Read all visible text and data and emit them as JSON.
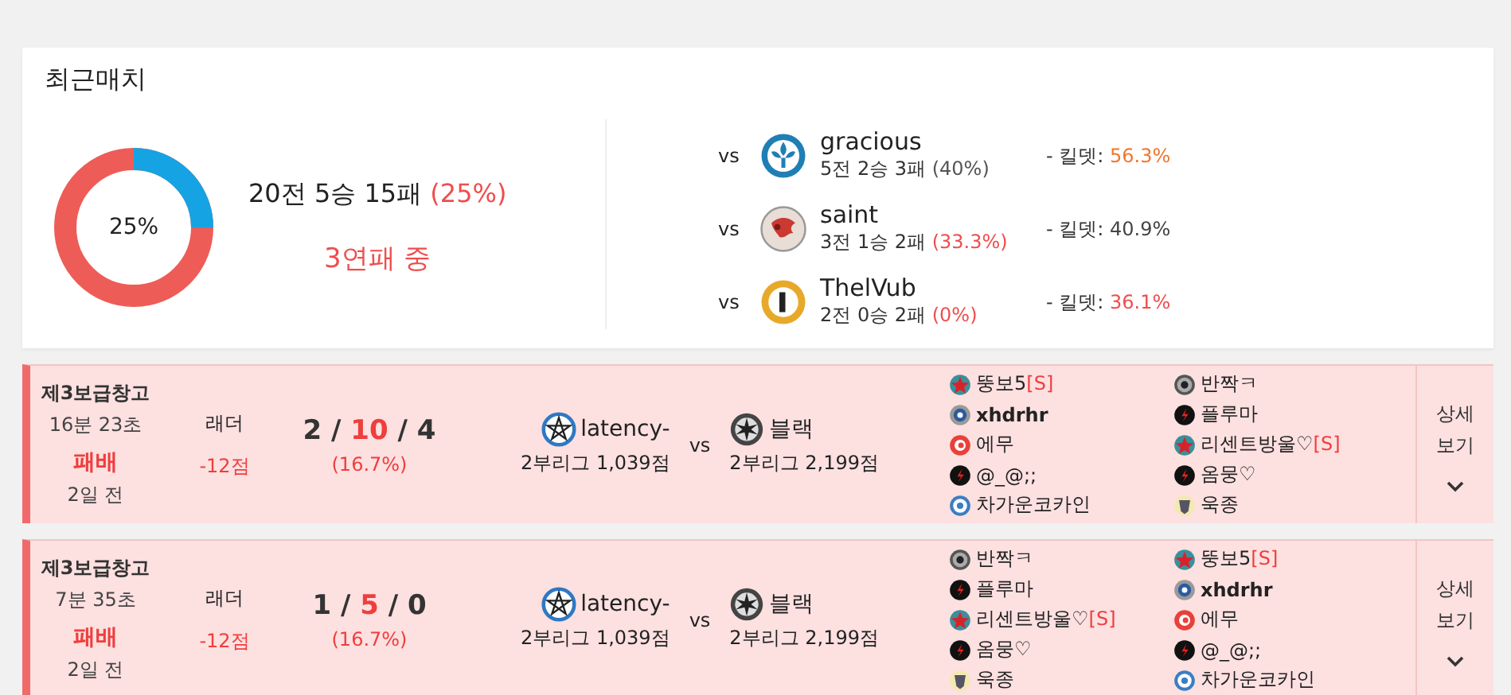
{
  "title": "최근매치",
  "summary": {
    "level": 0.25,
    "center_label": "25%",
    "record": "20전 5승 15패",
    "record_rate": "(25%)",
    "streak": "3연패 중"
  },
  "opponents": [
    {
      "vs": "vs",
      "kind": "fleur",
      "name": "gracious",
      "record": "5전 2승 3패",
      "rate": {
        "text": "(40%)",
        "color": "#555555"
      },
      "kd_label": "- 킬뎃:",
      "kd": {
        "text": "56.3%",
        "color": "#f0762f"
      }
    },
    {
      "vs": "vs",
      "kind": "dragon",
      "name": "saint",
      "record": "3전 1승 2패",
      "rate": {
        "text": "(33.3%)",
        "color": "#ef4e4e"
      },
      "kd_label": "- 킬뎃:",
      "kd": {
        "text": "40.9%",
        "color": "#444444"
      }
    },
    {
      "vs": "vs",
      "kind": "number",
      "name": "ThelVub",
      "record": "2전 0승 2패",
      "rate": {
        "text": "(0%)",
        "color": "#ef4e4e"
      },
      "kd_label": "- 킬뎃:",
      "kd": {
        "text": "36.1%",
        "color": "#ef4e4e"
      }
    }
  ],
  "matches": [
    {
      "kind": "loss",
      "map": "제3보급창고",
      "duration": "16분 23초",
      "result": "패배",
      "ago": "2일 전",
      "mode": "래더",
      "points": "-12점",
      "kills": "2",
      "deaths": "10",
      "assists": "4",
      "separator": "/",
      "ratio": "(16.7%)",
      "team": {
        "kind": "pentagram",
        "name": "latency-",
        "league": "2부리그 1,039점"
      },
      "vs": "vs",
      "opponent": {
        "kind": "sunburst",
        "name": "블랙",
        "league": "2부리그 2,199점"
      },
      "players": [
        [
          {
            "kind": "star",
            "name": "뚱보5",
            "tag": "[S]",
            "me": false
          },
          {
            "kind": "wheel",
            "name": "xhdrhr",
            "me": true
          },
          {
            "kind": "swirl",
            "name": "에무",
            "me": false
          },
          {
            "kind": "bolt",
            "name": "@_@;;",
            "me": false
          },
          {
            "kind": "gear",
            "name": "차가운코카인",
            "me": false
          }
        ],
        [
          {
            "kind": "radial",
            "name": "반짝ㅋ",
            "me": false
          },
          {
            "kind": "bolt",
            "name": "플루마",
            "me": false
          },
          {
            "kind": "star",
            "name": "리센트방울♡",
            "tag": "[S]",
            "me": false
          },
          {
            "kind": "bolt",
            "name": "옴뭉♡",
            "me": false
          },
          {
            "kind": "shield",
            "name": "욱종",
            "me": false
          }
        ]
      ],
      "detail": "상세 보기"
    },
    {
      "kind": "loss",
      "map": "제3보급창고",
      "duration": "7분 35초",
      "result": "패배",
      "ago": "2일 전",
      "mode": "래더",
      "points": "-12점",
      "kills": "1",
      "deaths": "5",
      "assists": "0",
      "separator": "/",
      "ratio": "(16.7%)",
      "team": {
        "kind": "pentagram",
        "name": "latency-",
        "league": "2부리그 1,039점"
      },
      "vs": "vs",
      "opponent": {
        "kind": "sunburst",
        "name": "블랙",
        "league": "2부리그 2,199점"
      },
      "players": [
        [
          {
            "kind": "radial",
            "name": "반짝ㅋ",
            "me": false
          },
          {
            "kind": "bolt",
            "name": "플루마",
            "me": false
          },
          {
            "kind": "star",
            "name": "리센트방울♡",
            "tag": "[S]",
            "me": false
          },
          {
            "kind": "bolt",
            "name": "옴뭉♡",
            "me": false
          },
          {
            "kind": "shield",
            "name": "욱종",
            "me": false
          }
        ],
        [
          {
            "kind": "star",
            "name": "뚱보5",
            "tag": "[S]",
            "me": false
          },
          {
            "kind": "wheel",
            "name": "xhdrhr",
            "me": true
          },
          {
            "kind": "swirl",
            "name": "에무",
            "me": false
          },
          {
            "kind": "bolt",
            "name": "@_@;;",
            "me": false
          },
          {
            "kind": "gear",
            "name": "차가운코카인",
            "me": false
          }
        ]
      ],
      "detail": "상세 보기"
    }
  ]
}
